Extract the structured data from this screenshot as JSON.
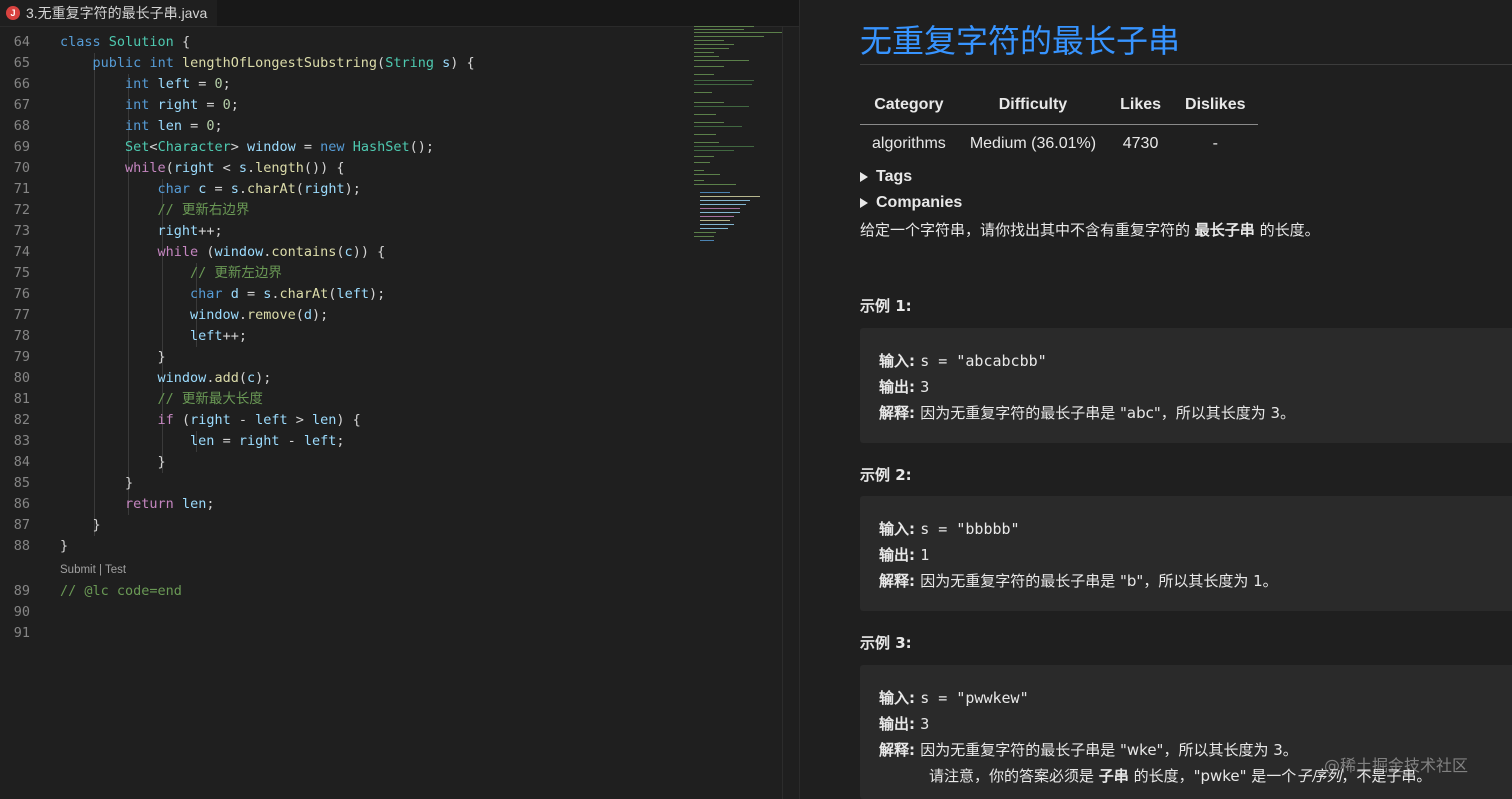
{
  "editor": {
    "tab": {
      "icon_letter": "J",
      "label": "3.无重复字符的最长子串.java"
    },
    "lines": [
      {
        "num": "64",
        "text": "class Solution {"
      },
      {
        "num": "65",
        "text": "    public int lengthOfLongestSubstring(String s) {"
      },
      {
        "num": "66",
        "text": "        int left = 0;"
      },
      {
        "num": "67",
        "text": "        int right = 0;"
      },
      {
        "num": "68",
        "text": "        int len = 0;"
      },
      {
        "num": "69",
        "text": "        Set<Character> window = new HashSet();"
      },
      {
        "num": "70",
        "text": "        while(right < s.length()) {"
      },
      {
        "num": "71",
        "text": "            char c = s.charAt(right);"
      },
      {
        "num": "72",
        "text": "            // 更新右边界"
      },
      {
        "num": "73",
        "text": "            right++;"
      },
      {
        "num": "74",
        "text": "            while (window.contains(c)) {"
      },
      {
        "num": "75",
        "text": "                // 更新左边界"
      },
      {
        "num": "76",
        "text": "                char d = s.charAt(left);"
      },
      {
        "num": "77",
        "text": "                window.remove(d);"
      },
      {
        "num": "78",
        "text": "                left++;"
      },
      {
        "num": "79",
        "text": "            }"
      },
      {
        "num": "80",
        "text": "            window.add(c);"
      },
      {
        "num": "81",
        "text": "            // 更新最大长度"
      },
      {
        "num": "82",
        "text": "            if (right - left > len) {"
      },
      {
        "num": "83",
        "text": "                len = right - left;"
      },
      {
        "num": "84",
        "text": "            }"
      },
      {
        "num": "85",
        "text": "        }"
      },
      {
        "num": "86",
        "text": "        return len;"
      },
      {
        "num": "87",
        "text": "    }"
      },
      {
        "num": "88",
        "text": "}"
      }
    ],
    "codelens": "Submit | Test",
    "tail_lines": [
      {
        "num": "89",
        "text": "// @lc code=end"
      },
      {
        "num": "90",
        "text": ""
      },
      {
        "num": "91",
        "text": ""
      }
    ]
  },
  "problem": {
    "title": "无重复字符的最长子串",
    "table": {
      "headers": [
        "Category",
        "Difficulty",
        "Likes",
        "Dislikes"
      ],
      "row": [
        "algorithms",
        "Medium (36.01%)",
        "4730",
        "-"
      ]
    },
    "tags_label": "Tags",
    "companies_label": "Companies",
    "description": {
      "before": "给定一个字符串，请你找出其中不含有重复字符的 ",
      "bold": "最长子串",
      "after": " 的长度。"
    },
    "examples": [
      {
        "title": "示例 1:",
        "input_label": "输入: ",
        "input": "s = \"abcabcbb\"",
        "output_label": "输出: ",
        "output": "3",
        "explain_label": "解释: ",
        "explain": "因为无重复字符的最长子串是 \"abc\"，所以其长度为 3。"
      },
      {
        "title": "示例 2:",
        "input_label": "输入: ",
        "input": "s = \"bbbbb\"",
        "output_label": "输出: ",
        "output": "1",
        "explain_label": "解释: ",
        "explain": "因为无重复字符的最长子串是 \"b\"，所以其长度为 1。"
      },
      {
        "title": "示例 3:",
        "input_label": "输入: ",
        "input": "s = \"pwwkew\"",
        "output_label": "输出: ",
        "output": "3",
        "explain_label": "解释: ",
        "explain": "因为无重复字符的最长子串是 \"wke\"，所以其长度为 3。",
        "note_a": "请注意，你的答案必须是 ",
        "note_b": "子串",
        "note_c": " 的长度，\"pwke\" 是一个",
        "note_d": "子序列",
        "note_e": "，不是子串。"
      }
    ],
    "watermark": "@稀土掘金技术社区"
  }
}
